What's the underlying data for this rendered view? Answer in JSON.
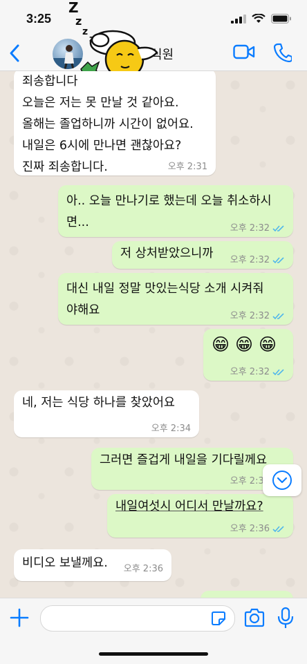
{
  "status": {
    "time": "3:25"
  },
  "header": {
    "contact_name": "식원"
  },
  "messages": [
    {
      "dir": "in",
      "text": "죄송합니다\n오늘은 저는 못 만날 것 같아요.\n올해는 졸업하니까 시간이 없어요.\n내일은 6시에 만나면 괜찮아요?\n진짜 죄송합니다.",
      "time": "오후 2:31"
    },
    {
      "dir": "out",
      "text": "아.. 오늘 만나기로 했는데 오늘 취소하시\n면...",
      "time": "오후 2:32"
    },
    {
      "dir": "out",
      "text": "저 상처받았으니까",
      "time": "오후 2:32"
    },
    {
      "dir": "out",
      "text": "대신 내일 정말 맛있는식당 소개 시켜줘\n야해요",
      "time": "오후 2:32"
    },
    {
      "dir": "out",
      "text": "😁 😁 😁",
      "time": "오후 2:32"
    },
    {
      "dir": "in",
      "text": "네, 저는 식당 하나를 찾았어요",
      "time": "오후 2:34"
    },
    {
      "dir": "out",
      "text": "그러면 즐겁게 내일을 기다릴께요",
      "time": "오후 2:36"
    },
    {
      "dir": "out",
      "text": "내일여섯시 어디서 만날까요?",
      "time": "오후 2:36"
    },
    {
      "dir": "in",
      "text": "비디오 보낼께요.",
      "time": "오후 2:36"
    }
  ],
  "icons": {
    "back": "chevron-left-icon",
    "video": "video-camera-icon",
    "phone": "phone-icon",
    "scroll": "chevron-down-icon",
    "attach": "plus-icon",
    "sticker": "sticker-icon",
    "camera": "camera-icon",
    "mic": "microphone-icon"
  },
  "colors": {
    "accent": "#0a7cff",
    "outgoing": "#dcf8c6",
    "incoming": "#ffffff",
    "read_ticks": "#4fb6ec"
  }
}
